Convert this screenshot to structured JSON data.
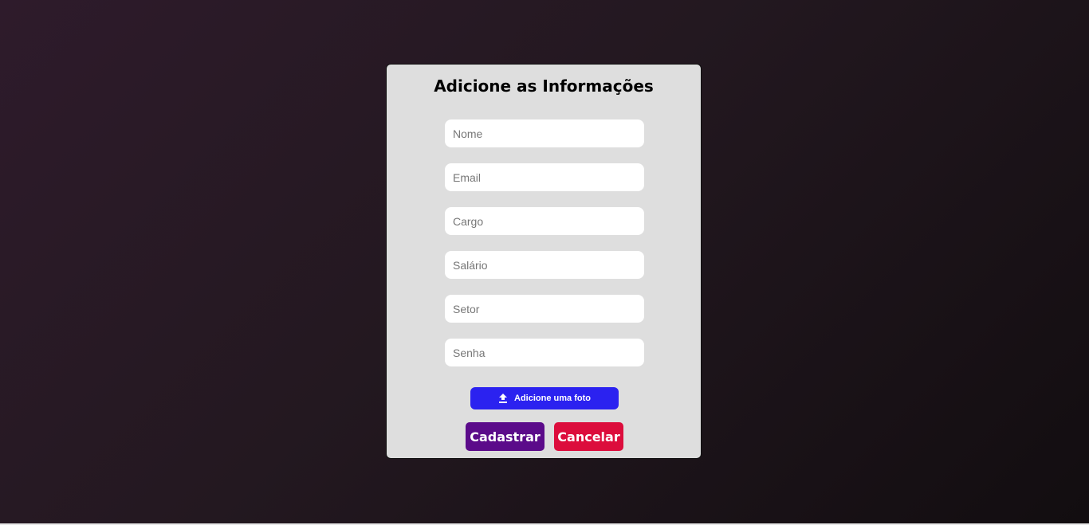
{
  "form": {
    "title": "Adicione as Informações",
    "fields": [
      {
        "name": "nome",
        "placeholder": "Nome",
        "value": ""
      },
      {
        "name": "email",
        "placeholder": "Email",
        "value": ""
      },
      {
        "name": "cargo",
        "placeholder": "Cargo",
        "value": ""
      },
      {
        "name": "salario",
        "placeholder": "Salário",
        "value": ""
      },
      {
        "name": "setor",
        "placeholder": "Setor",
        "value": ""
      },
      {
        "name": "senha",
        "placeholder": "Senha",
        "value": ""
      }
    ],
    "upload": {
      "label": "Adicione uma foto",
      "icon": "upload-icon"
    },
    "actions": {
      "submit_label": "Cadastrar",
      "cancel_label": "Cancelar"
    }
  },
  "colors": {
    "card_background": "#dedede",
    "upload_button": "#2b22f0",
    "submit_button": "#5b0b8a",
    "cancel_button": "#dc0d3c"
  }
}
